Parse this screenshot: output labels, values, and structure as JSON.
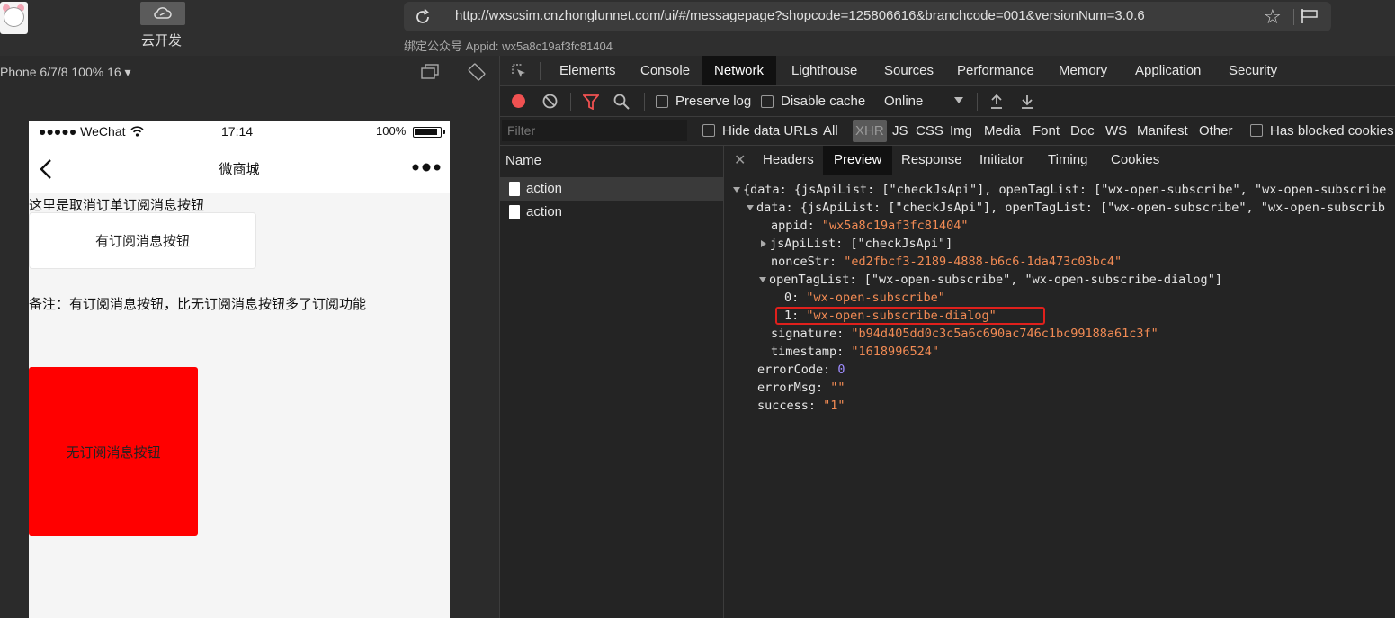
{
  "topbar": {
    "cloud_label": "云开发",
    "url": "http://wxscsim.cnzhonglunnet.com/ui/#/messagepage?shopcode=125806616&branchcode=001&versionNum=3.0.6",
    "appid_line": "绑定公众号 Appid: wx5a8c19af3fc81404"
  },
  "simulator": {
    "device_label": "Phone 6/7/8 100% 16 ▾",
    "status": {
      "carrier": "●●●●● WeChat",
      "time": "17:14",
      "battery": "100%"
    },
    "nav_title": "微商城",
    "text1": "这里是取消订单订阅消息按钮",
    "subscribe_button": "有订阅消息按钮",
    "text2": "备注：有订阅消息按钮，比无订阅消息按钮多了订阅功能",
    "red_button": "无订阅消息按钮"
  },
  "devtools": {
    "tabs": [
      "Elements",
      "Console",
      "Network",
      "Lighthouse",
      "Sources",
      "Performance",
      "Memory",
      "Application",
      "Security"
    ],
    "active_tab": "Network",
    "toolbar": {
      "preserve_log": "Preserve log",
      "disable_cache": "Disable cache",
      "throttle": "Online"
    },
    "filter": {
      "placeholder": "Filter",
      "hide_data_urls": "Hide data URLs",
      "types": [
        "All",
        "XHR",
        "JS",
        "CSS",
        "Img",
        "Media",
        "Font",
        "Doc",
        "WS",
        "Manifest",
        "Other"
      ],
      "active_type": "XHR",
      "has_blocked": "Has blocked cookies"
    },
    "name_header": "Name",
    "requests": [
      "action",
      "action"
    ],
    "detail_tabs": [
      "Headers",
      "Preview",
      "Response",
      "Initiator",
      "Timing",
      "Cookies"
    ],
    "active_detail_tab": "Preview",
    "preview": {
      "line0": "{data: {jsApiList: [\"checkJsApi\"], openTagList: [\"wx-open-subscribe\", \"wx-open-subscribe",
      "line1": "data: {jsApiList: [\"checkJsApi\"], openTagList: [\"wx-open-subscribe\", \"wx-open-subscrib",
      "appid_key": "appid:",
      "appid_val": "\"wx5a8c19af3fc81404\"",
      "jsapi_key": "jsApiList:",
      "jsapi_val": "[\"checkJsApi\"]",
      "nonce_key": "nonceStr:",
      "nonce_val": "\"ed2fbcf3-2189-4888-b6c6-1da473c03bc4\"",
      "opentag_key": "openTagList:",
      "opentag_val": "[\"wx-open-subscribe\", \"wx-open-subscribe-dialog\"]",
      "item0_key": "0:",
      "item0_val": "\"wx-open-subscribe\"",
      "item1_key": "1:",
      "item1_val": "\"wx-open-subscribe-dialog\"",
      "sig_key": "signature:",
      "sig_val": "\"b94d405dd0c3c5a6c690ac746c1bc99188a61c3f\"",
      "ts_key": "timestamp:",
      "ts_val": "\"1618996524\"",
      "errcode_key": "errorCode:",
      "errcode_val": "0",
      "errmsg_key": "errorMsg:",
      "errmsg_val": "\"\"",
      "success_key": "success:",
      "success_val": "\"1\""
    }
  }
}
